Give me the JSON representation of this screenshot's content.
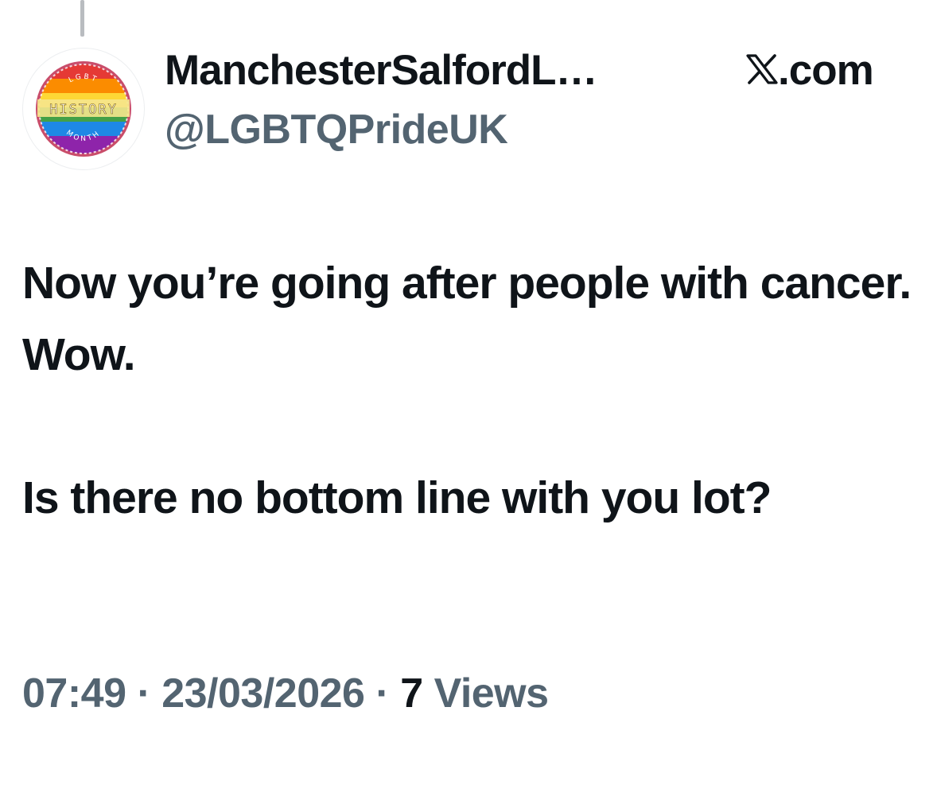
{
  "post": {
    "author": {
      "display_name": "ManchesterSalfordL…",
      "handle": "@LGBTQPrideUK",
      "avatar": {
        "icon": "lgbt-history-month-badge",
        "text_top": "LGBT",
        "text_middle": "HISTORY",
        "text_bottom": "MONTH",
        "colors": [
          "#e53935",
          "#fb8c00",
          "#fdd835",
          "#43a047",
          "#1e88e5",
          "#8e24aa"
        ]
      }
    },
    "source": {
      "icon": "x-logo-icon",
      "label": ".com"
    },
    "text": {
      "paragraph_1": "Now you’re going after people with cancer. Wow.",
      "paragraph_2": "Is there no bottom line with you lot?"
    },
    "meta": {
      "time": "07:49",
      "separator": " · ",
      "date": "23/03/2026",
      "views_count": "7",
      "views_label": " Views"
    }
  },
  "colors": {
    "text_primary": "#0f1419",
    "text_secondary": "#536471",
    "thread_line": "#b9bcc0"
  }
}
